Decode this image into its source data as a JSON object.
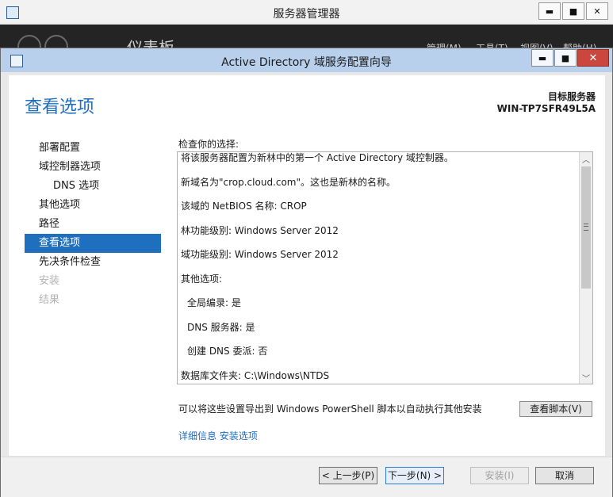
{
  "bg_window": {
    "title": "服务器管理器",
    "heading": "仪表板",
    "menu": [
      "管理(M)",
      "工具(T)",
      "视图(V)",
      "帮助(H)"
    ],
    "controls": {
      "minimize": "▬",
      "maximize": "■",
      "close": "✕"
    }
  },
  "wizard": {
    "title": "Active Directory 域服务配置向导",
    "controls": {
      "minimize": "▬",
      "maximize": "■",
      "close": "✕"
    },
    "page_title": "查看选项",
    "target_label": "目标服务器",
    "target_server": "WIN-TP7SFR49L5A",
    "nav": [
      {
        "label": "部署配置"
      },
      {
        "label": "域控制器选项"
      },
      {
        "label": "DNS 选项"
      },
      {
        "label": "其他选项"
      },
      {
        "label": "路径"
      },
      {
        "label": "查看选项"
      },
      {
        "label": "先决条件检查"
      },
      {
        "label": "安装"
      },
      {
        "label": "结果"
      }
    ],
    "check_label": "检查你的选择:",
    "review_lines": [
      "将该服务器配置为新林中的第一个 Active Directory 域控制器。",
      "新域名为\"crop.cloud.com\"。这也是新林的名称。",
      "该域的 NetBIOS 名称: CROP",
      "林功能级别: Windows Server 2012",
      "域功能级别: Windows Server 2012",
      "其他选项:",
      "全局编录: 是",
      "DNS 服务器: 是",
      "创建 DNS 委派: 否",
      "数据库文件夹: C:\\Windows\\NTDS"
    ],
    "export_text": "可以将这些设置导出到 Windows PowerShell 脚本以自动执行其他安装",
    "view_script_button": "查看脚本(V)",
    "more_link": "详细信息 安装选项",
    "buttons": {
      "prev": "< 上一步(P)",
      "next": "下一步(N) >",
      "install": "安装(I)",
      "cancel": "取消"
    }
  },
  "colors": {
    "accent": "#1f6fbf",
    "titlebar": "#b8d0ec",
    "close": "#c9473f"
  }
}
